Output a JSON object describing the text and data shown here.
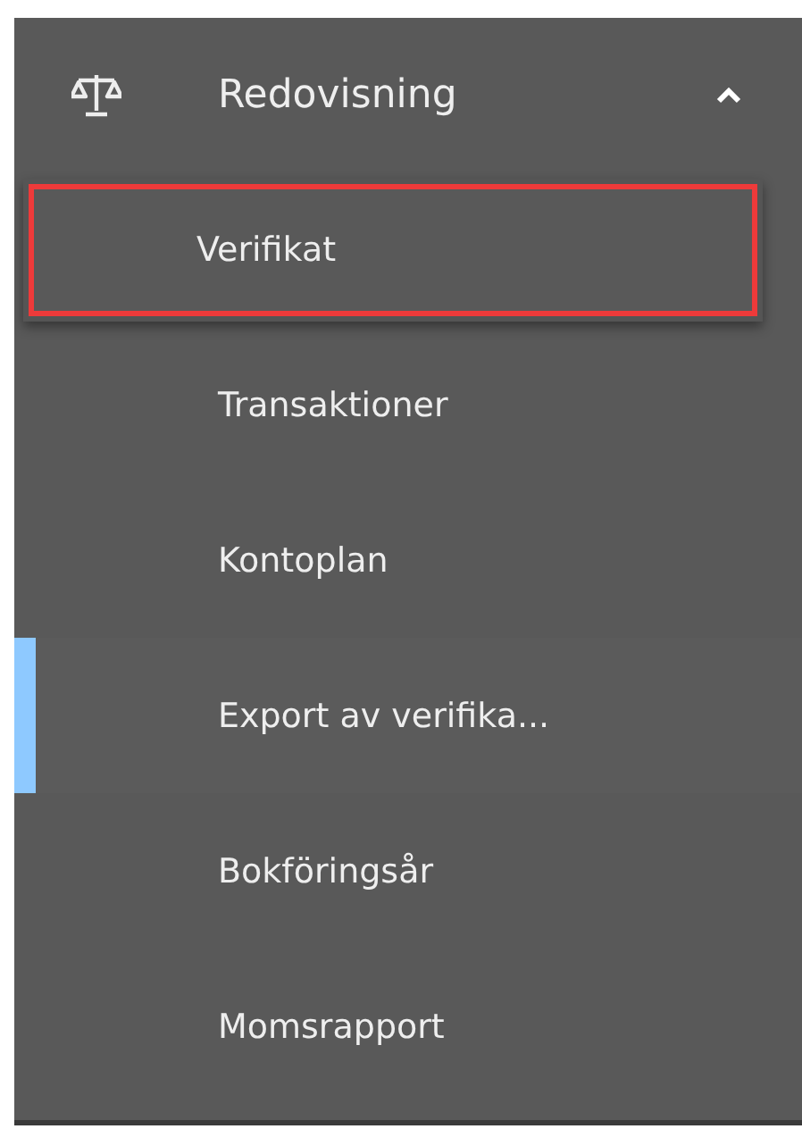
{
  "section": {
    "title": "Redovisning",
    "expanded": true
  },
  "items": [
    {
      "label": "Verifikat",
      "selected": false,
      "outlined": true
    },
    {
      "label": "Transaktioner",
      "selected": false,
      "outlined": false
    },
    {
      "label": "Kontoplan",
      "selected": false,
      "outlined": false
    },
    {
      "label": "Export av verifika...",
      "selected": true,
      "outlined": false
    },
    {
      "label": "Bokföringsår",
      "selected": false,
      "outlined": false
    },
    {
      "label": "Momsrapport",
      "selected": false,
      "outlined": false
    }
  ]
}
